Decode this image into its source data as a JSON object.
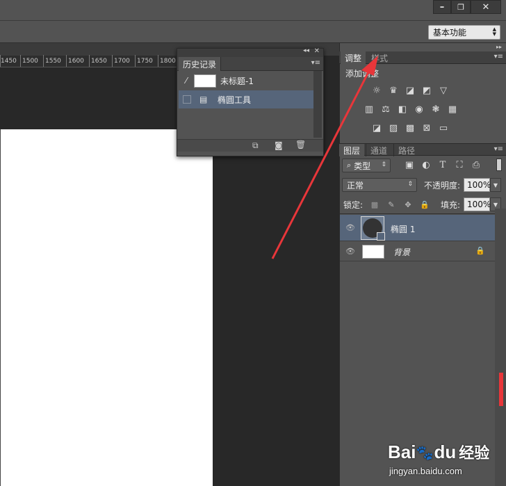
{
  "window": {
    "minimize": "–",
    "restore": "❐",
    "close": "✕"
  },
  "workspace": {
    "value": "基本功能"
  },
  "ruler": {
    "ticks": [
      "1450",
      "1500",
      "1550",
      "1600",
      "1650",
      "1700",
      "1750",
      "1800"
    ]
  },
  "history": {
    "title": "历史记录",
    "snapshot_label": "未标题-1",
    "items": [
      {
        "label": "椭圆工具"
      }
    ]
  },
  "adjustments": {
    "tab_adjust": "调整",
    "tab_styles": "样式",
    "add_label": "添加调整"
  },
  "layers": {
    "tab_layers": "图层",
    "tab_channels": "通道",
    "tab_paths": "路径",
    "filter_kind": "类型",
    "blend_mode": "正常",
    "opacity_label": "不透明度:",
    "opacity_value": "100%",
    "lock_label": "锁定:",
    "fill_label": "填充:",
    "fill_value": "100%",
    "items": [
      {
        "name": "椭圆 1",
        "selected": true
      },
      {
        "name": "背景",
        "locked": true
      }
    ]
  },
  "watermark": {
    "brand": "Bai",
    "brand2": "du",
    "suffix": "经验",
    "url": "jingyan.baidu.com"
  },
  "colors": {
    "accent_selected_row": "#56657a",
    "annotation_arrow": "#e8363a",
    "panel_bg": "#535353",
    "canvas_bg": "#282828"
  }
}
